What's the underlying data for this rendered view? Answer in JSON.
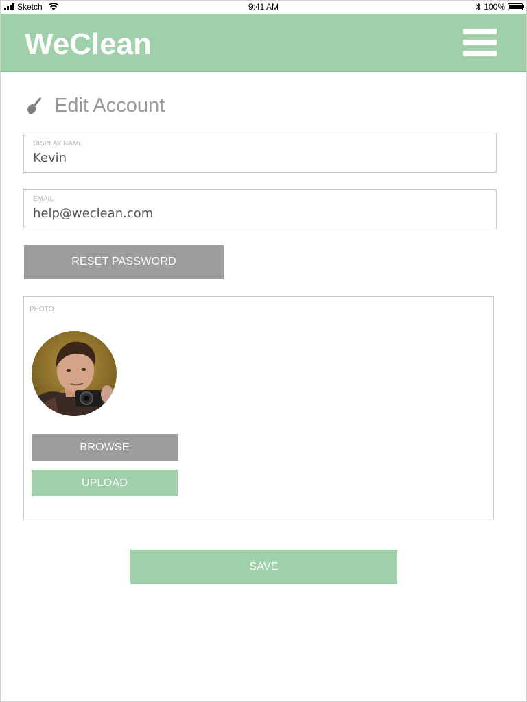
{
  "status_bar": {
    "carrier": "Sketch",
    "time": "9:41 AM",
    "battery": "100%",
    "battery_level": 1.0
  },
  "header": {
    "brand": "WeClean",
    "menu_icon": "hamburger-menu-icon",
    "background": "#9fd0aa"
  },
  "page": {
    "title": "Edit Account",
    "title_icon": "broom-icon"
  },
  "form": {
    "display_name": {
      "label": "DISPLAY NAME",
      "value": "Kevin"
    },
    "email": {
      "label": "EMAIL",
      "value": "help@weclean.com"
    },
    "reset_password_label": "RESET PASSWORD"
  },
  "photo": {
    "label": "PHOTO",
    "browse_label": "BROWSE",
    "upload_label": "UPLOAD"
  },
  "save_label": "SAVE",
  "colors": {
    "accent_green": "#9fd0aa",
    "button_gray": "#9d9d9d"
  }
}
